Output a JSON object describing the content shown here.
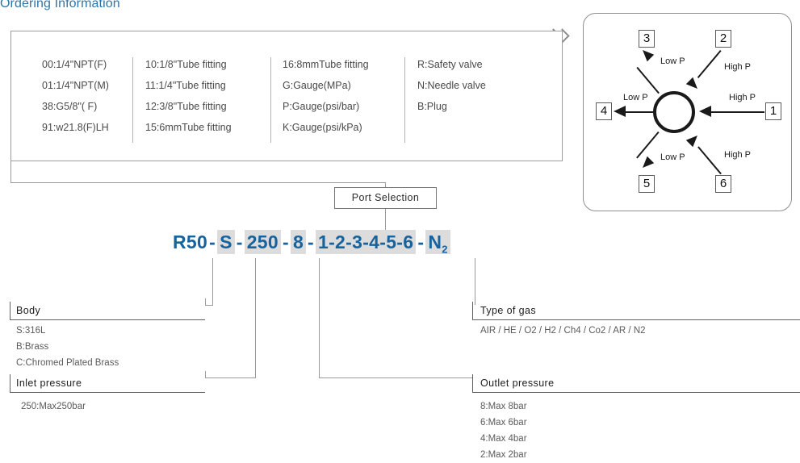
{
  "page": {
    "title": "Ordering Information"
  },
  "option_table": {
    "columns": [
      {
        "items": [
          "00:1/4\"NPT(F)",
          "01:1/4\"NPT(M)",
          "38:G5/8\"( F)",
          "91:w21.8(F)LH"
        ]
      },
      {
        "items": [
          "10:1/8\"Tube fitting",
          "11:1/4\"Tube fitting",
          "12:3/8\"Tube fitting",
          "15:6mmTube fitting"
        ]
      },
      {
        "items": [
          "16:8mmTube fitting",
          "G:Gauge(MPa)",
          "P:Gauge(psi/bar)",
          "K:Gauge(psi/kPa)"
        ]
      },
      {
        "items": [
          "R:Safety valve",
          "N:Needle valve",
          "B:Plug"
        ]
      }
    ]
  },
  "port_diagram": {
    "ports": [
      {
        "id": "1",
        "label": "High P"
      },
      {
        "id": "2",
        "label": "High P"
      },
      {
        "id": "3",
        "label": "Low P"
      },
      {
        "id": "4",
        "label": "Low P"
      },
      {
        "id": "5",
        "label": "Low P"
      },
      {
        "id": "6",
        "label": "High P"
      }
    ]
  },
  "product_code": {
    "body_series": "R50",
    "body": "S",
    "inlet": "250",
    "outlet": "8",
    "ports": "1-2-3-4-5-6",
    "gas": "N",
    "gas_sub": "2",
    "dash": "-"
  },
  "port_selection": {
    "label": "Port Selection"
  },
  "legends": {
    "body": {
      "title": "Body",
      "items": [
        "S:316L",
        "B:Brass",
        "C:Chromed Plated Brass"
      ]
    },
    "inlet_pressure": {
      "title": "Inlet pressure",
      "items": [
        "250:Max250bar"
      ]
    },
    "type_of_gas": {
      "title": "Type of gas",
      "items": [
        "AIR / HE / O2  / H2  / Ch4 / Co2  / AR / N2"
      ]
    },
    "outlet_pressure": {
      "title": "Outlet pressure",
      "items": [
        "8:Max 8bar",
        "6:Max 6bar",
        "4:Max 4bar",
        "2:Max 2bar"
      ]
    }
  },
  "colors": {
    "accent_blue": "#16639e",
    "title_blue": "#2e75a8",
    "highlight_gray": "#dcdcdc",
    "line_gray": "#9a9a9a"
  }
}
